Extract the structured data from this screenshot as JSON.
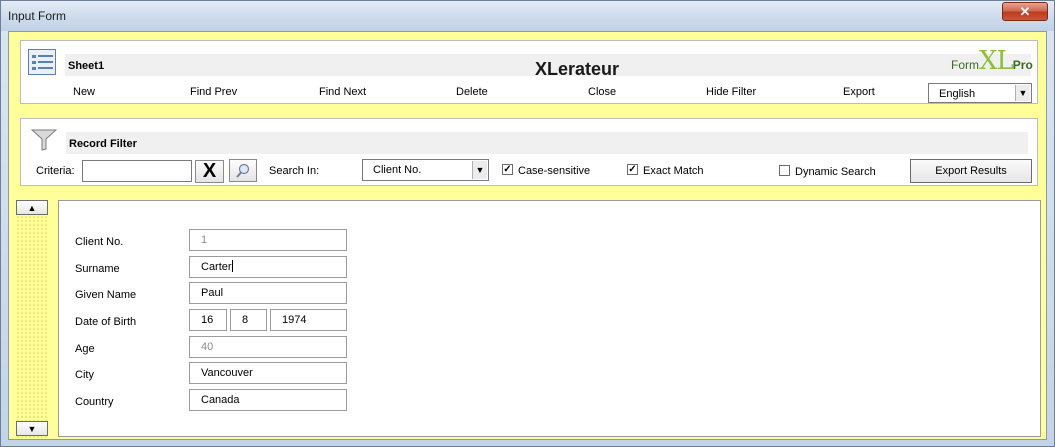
{
  "window": {
    "title": "Input Form",
    "close_glyph": "✕"
  },
  "ribbon": {
    "sheet_name": "Sheet1",
    "app_title": "XLerateur",
    "brand": {
      "form": "Form",
      "xl": "XL",
      "pro": "Pro"
    },
    "menu": [
      "New",
      "Find Prev",
      "Find Next",
      "Delete",
      "Close",
      "Hide Filter",
      "Export"
    ],
    "language": "English"
  },
  "filter": {
    "title": "Record Filter",
    "criteria_label": "Criteria:",
    "criteria_value": "",
    "clear_glyph": "X",
    "search_in_label": "Search In:",
    "search_in_value": "Client No.",
    "case_sensitive": {
      "label": "Case-sensitive",
      "checked": true
    },
    "exact_match": {
      "label": "Exact Match",
      "checked": true
    },
    "dynamic_search": {
      "label": "Dynamic Search",
      "checked": false
    },
    "export_results": "Export Results"
  },
  "record": {
    "client_no": {
      "label": "Client No.",
      "value": "1"
    },
    "surname": {
      "label": "Surname",
      "value": "Carter"
    },
    "given_name": {
      "label": "Given Name",
      "value": "Paul"
    },
    "date_of_birth": {
      "label": "Date of Birth",
      "day": "16",
      "month": "8",
      "year": "1974"
    },
    "age": {
      "label": "Age",
      "value": "40"
    },
    "city": {
      "label": "City",
      "value": "Vancouver"
    },
    "country": {
      "label": "Country",
      "value": "Canada"
    }
  },
  "icons": [
    "sheet-icon",
    "funnel-icon",
    "magnifier-icon",
    "scroll-up-icon",
    "scroll-down-icon",
    "dropdown-arrow-icon"
  ]
}
